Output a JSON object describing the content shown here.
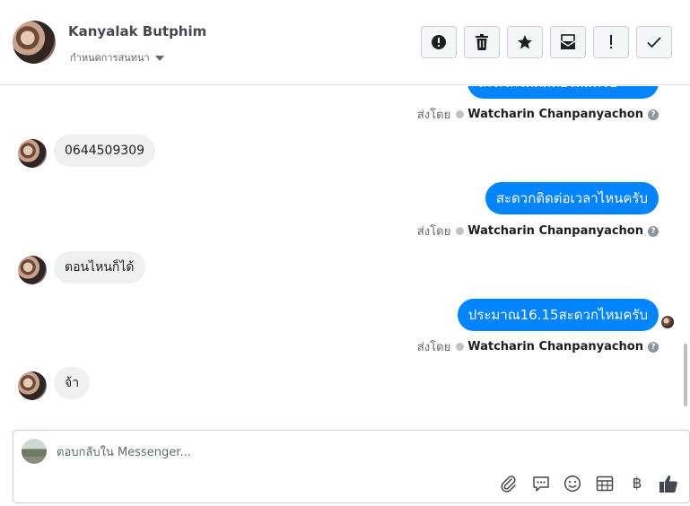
{
  "header": {
    "contact_name": "Kanyalak Butphim",
    "assign_label": "กำหนดการสนทนา",
    "toolbar": [
      {
        "name": "spam-button",
        "icon": "alert-circle-icon"
      },
      {
        "name": "delete-button",
        "icon": "trash-icon"
      },
      {
        "name": "star-button",
        "icon": "star-icon"
      },
      {
        "name": "mark-unread-button",
        "icon": "envelope-icon"
      },
      {
        "name": "follow-up-button",
        "icon": "exclamation-icon"
      },
      {
        "name": "mark-done-button",
        "icon": "check-icon"
      }
    ]
  },
  "thread": {
    "messages": [
      {
        "direction": "out",
        "text": "สะดวกให้ติดต่อไหมครับ",
        "partial": true
      },
      {
        "direction": "meta",
        "sent_by_label": "ส่งโดย",
        "sender": "Watcharin Chanpanyachon"
      },
      {
        "direction": "in",
        "text": "0644509309"
      },
      {
        "direction": "out",
        "text": "สะดวกติดต่อเวลาไหนครับ"
      },
      {
        "direction": "meta",
        "sent_by_label": "ส่งโดย",
        "sender": "Watcharin Chanpanyachon"
      },
      {
        "direction": "in",
        "text": "ตอนไหนก็ได้"
      },
      {
        "direction": "out",
        "text": "ประมาณ16.15สะดวกไหมครับ"
      },
      {
        "direction": "meta",
        "sent_by_label": "ส่งโดย",
        "sender": "Watcharin Chanpanyachon"
      },
      {
        "direction": "in",
        "text": "จ้า"
      }
    ]
  },
  "composer": {
    "placeholder": "ตอบกลับใน Messenger...",
    "value": "",
    "actions": [
      "attach-icon",
      "saved-reply-icon",
      "emoji-icon",
      "appointment-icon",
      "payment-icon",
      "like-icon"
    ]
  },
  "colors": {
    "outgoing_bubble": "#0084ff",
    "incoming_bubble": "#f1f0f0",
    "toolbar_button_bg": "#f5f6f7"
  }
}
